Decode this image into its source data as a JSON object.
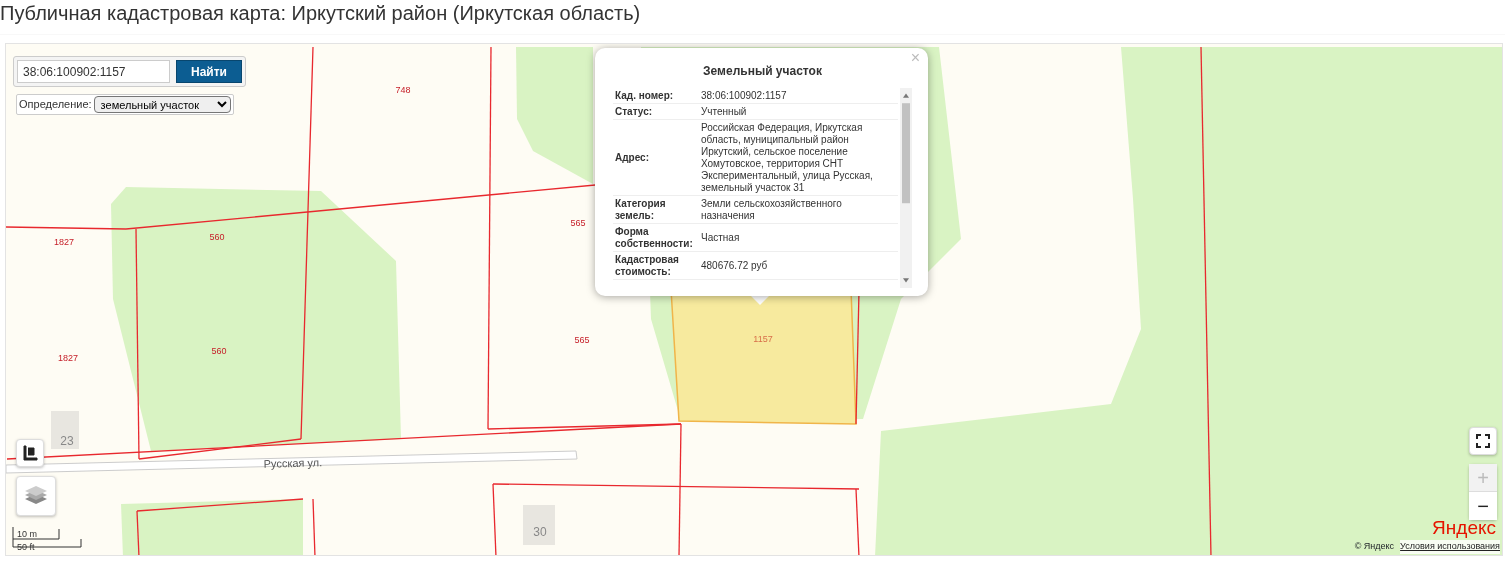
{
  "page_title": "Публичная кадастровая карта: Иркутский район (Иркутская область)",
  "search": {
    "value": "38:06:100902:1157",
    "button": "Найти"
  },
  "mode": {
    "label": "Определение:",
    "value": "земельный участок"
  },
  "map": {
    "parcel_labels": [
      "748",
      "1827",
      "560",
      "565",
      "1827",
      "560",
      "565",
      "1157"
    ],
    "building_numbers": [
      "23",
      "30"
    ],
    "street": "Русская ул.",
    "scale": [
      "10 m",
      "50 ft"
    ],
    "zoom_in": {
      "label": "+",
      "disabled": true
    },
    "zoom_out": {
      "label": "−",
      "disabled": false
    },
    "logo": "Яндекс",
    "copyright": "© Яндекс",
    "terms_link": "Условия использования"
  },
  "popup": {
    "title": "Земельный участок",
    "close": "×",
    "rows": [
      {
        "label": "Кад. номер:",
        "value": "38:06:100902:1157"
      },
      {
        "label": "Статус:",
        "value": "Учтенный"
      },
      {
        "label": "Адрес:",
        "value": "Российская Федерация, Иркутская область, муниципальный район Иркутский, сельское поселение Хомутовское, территория СНТ Экспериментальный, улица Русская, земельный участок 31"
      },
      {
        "label": "Категория земель:",
        "value": "Земли сельскохозяйственного назначения"
      },
      {
        "label": "Форма собственности:",
        "value": "Частная"
      },
      {
        "label": "Кадастровая стоимость:",
        "value": "480676.72 руб"
      }
    ]
  }
}
